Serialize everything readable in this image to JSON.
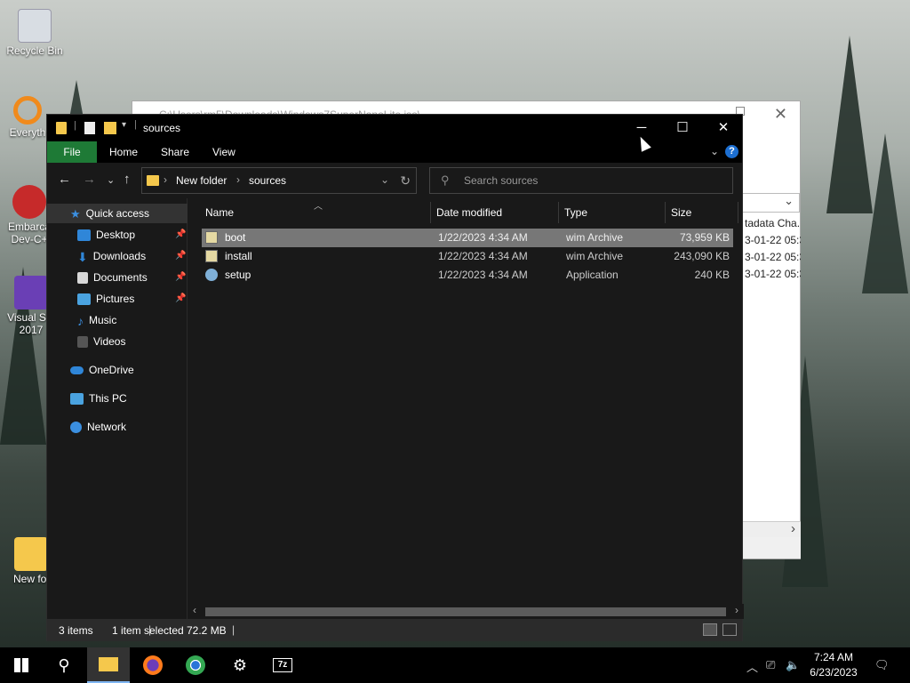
{
  "desktop": {
    "icons": [
      {
        "label": "Recycle Bin",
        "icon": "recycle-bin-icon"
      },
      {
        "label": "Everyth",
        "icon": "everything-search-icon"
      },
      {
        "label": "Embarca Dev-C+",
        "icon": "dev-cpp-icon"
      },
      {
        "label": "Visual Stu 2017",
        "icon": "visual-studio-icon"
      },
      {
        "label": "New fol",
        "icon": "folder-icon"
      }
    ]
  },
  "back_window": {
    "path": "C:\\Users\\rm5\\Downloads\\Windows7SuperNanoLite.iso\\",
    "column_header": "tadata Cha...",
    "rows": [
      "3-01-22 05:3",
      "3-01-22 05:3",
      "3-01-22 05:3"
    ]
  },
  "explorer": {
    "title": "sources",
    "ribbon_tabs": [
      "File",
      "Home",
      "Share",
      "View"
    ],
    "help_label": "?",
    "address": {
      "crumbs": [
        "New folder",
        "sources"
      ]
    },
    "search": {
      "placeholder": "Search sources"
    },
    "sidebar": {
      "quick_access": "Quick access",
      "items": [
        {
          "label": "Desktop",
          "pinned": true
        },
        {
          "label": "Downloads",
          "pinned": true
        },
        {
          "label": "Documents",
          "pinned": true
        },
        {
          "label": "Pictures",
          "pinned": true
        },
        {
          "label": "Music",
          "pinned": false
        },
        {
          "label": "Videos",
          "pinned": false
        }
      ],
      "onedrive": "OneDrive",
      "this_pc": "This PC",
      "network": "Network"
    },
    "columns": [
      "Name",
      "Date modified",
      "Type",
      "Size"
    ],
    "files": [
      {
        "name": "boot",
        "date": "1/22/2023 4:34 AM",
        "type": "wim Archive",
        "size": "73,959 KB",
        "selected": true
      },
      {
        "name": "install",
        "date": "1/22/2023 4:34 AM",
        "type": "wim Archive",
        "size": "243,090 KB",
        "selected": false
      },
      {
        "name": "setup",
        "date": "1/22/2023 4:34 AM",
        "type": "Application",
        "size": "240 KB",
        "selected": false
      }
    ],
    "status": {
      "items": "3 items",
      "selected": "1 item selected",
      "size": "72.2 MB"
    }
  },
  "taskbar": {
    "clock_time": "7:24 AM",
    "clock_date": "6/23/2023",
    "apps": [
      "start-icon",
      "search-icon",
      "file-explorer-icon",
      "firefox-icon",
      "chrome-icon",
      "settings-icon",
      "7zip-icon"
    ]
  },
  "colors": {
    "file_tab": "#1e7a36",
    "folder": "#f5c84c",
    "selection": "#777777",
    "accent": "#1d6fd1"
  }
}
